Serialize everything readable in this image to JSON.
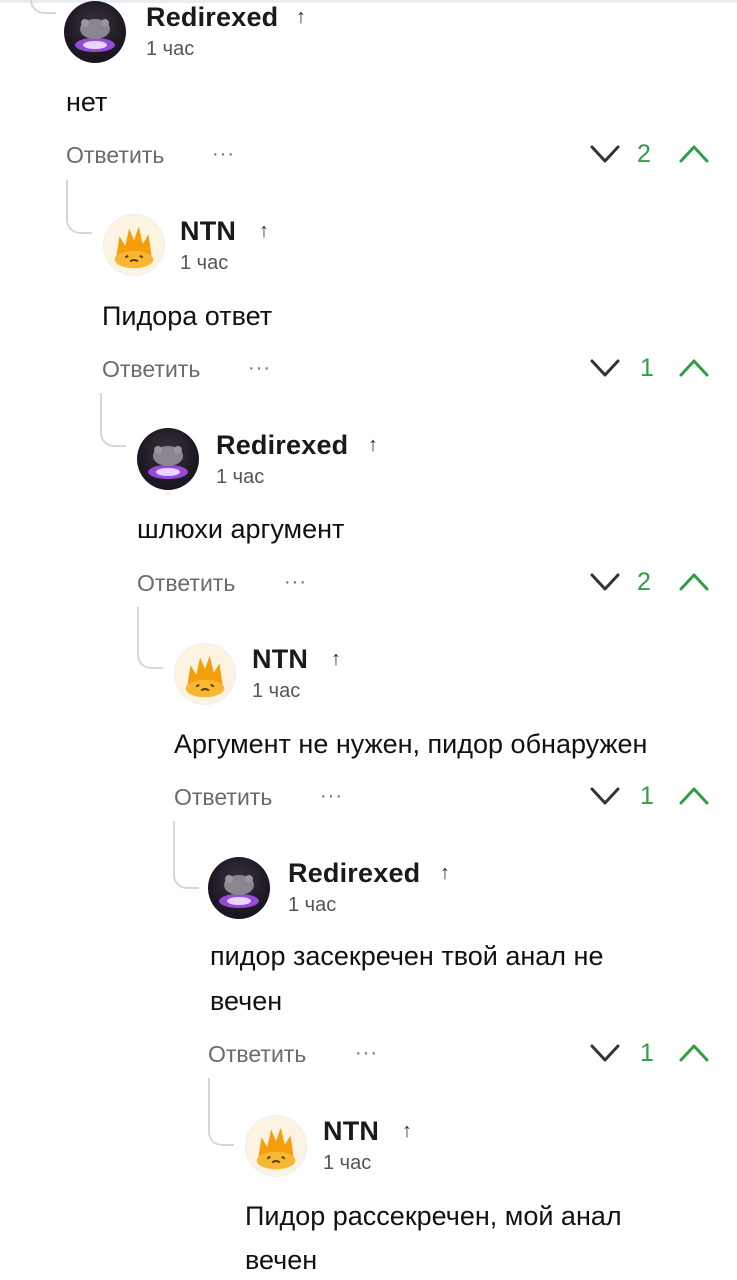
{
  "ui": {
    "reply_label": "Ответить",
    "more_label": "···",
    "up_arrow": "↑",
    "vote_up_color": "#2f9e44",
    "vote_down_color": "#333333"
  },
  "comments": [
    {
      "user": "Redirexed",
      "avatar": "rat-avatar",
      "time": "1 час",
      "lines": [
        "нет"
      ],
      "score": "2"
    },
    {
      "user": "NTN",
      "avatar": "fire-avatar",
      "time": "1 час",
      "lines": [
        "Пидора ответ"
      ],
      "score": "1"
    },
    {
      "user": "Redirexed",
      "avatar": "rat-avatar",
      "time": "1 час",
      "lines": [
        "шлюхи аргумент"
      ],
      "score": "2"
    },
    {
      "user": "NTN",
      "avatar": "fire-avatar",
      "time": "1 час",
      "lines": [
        "Аргумент не нужен, пидор обнаружен"
      ],
      "score": "1"
    },
    {
      "user": "Redirexed",
      "avatar": "rat-avatar",
      "time": "1 час",
      "lines": [
        "пидор засекречен твой анал не",
        "вечен"
      ],
      "score": "1"
    },
    {
      "user": "NTN",
      "avatar": "fire-avatar",
      "time": "1 час",
      "lines": [
        "Пидор рассекречен, мой анал",
        "вечен"
      ],
      "score": null
    }
  ]
}
